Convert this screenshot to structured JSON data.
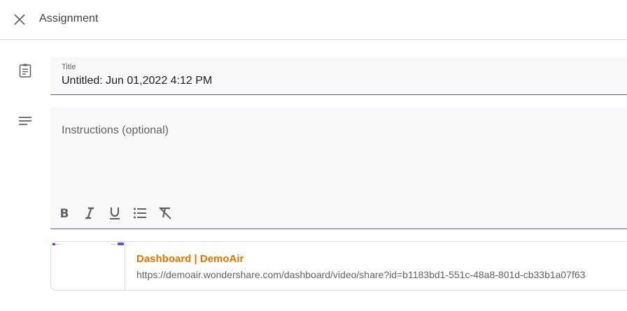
{
  "header": {
    "title": "Assignment",
    "close_icon": "close-icon"
  },
  "title_field": {
    "icon": "assignment-clipboard-icon",
    "label": "Title",
    "value": "Untitled: Jun 01,2022 4:12 PM"
  },
  "instructions_field": {
    "icon": "notes-lines-icon",
    "placeholder": "Instructions (optional)",
    "formatting": [
      "bold-icon",
      "italic-icon",
      "underline-icon",
      "bulleted-list-icon",
      "clear-formatting-icon"
    ]
  },
  "attachment": {
    "title": "Dashboard | DemoAir",
    "url": "https://demoair.wondershare.com/dashboard/video/share?id=b1183bd1-551c-48a8-801d-cb33b1a07f63",
    "title_color": "#e37400"
  }
}
